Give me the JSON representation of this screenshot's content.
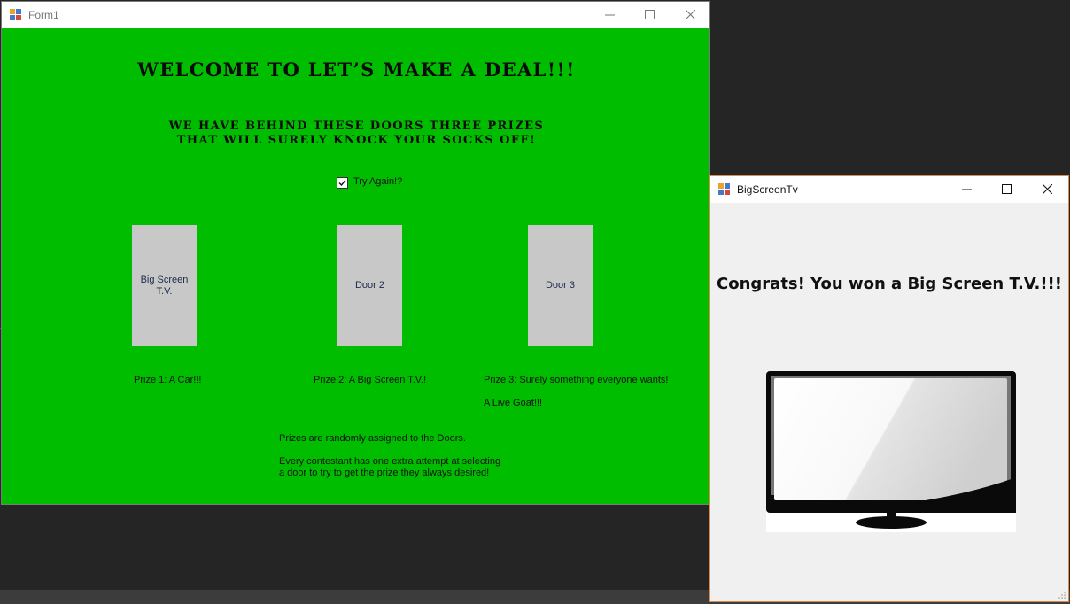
{
  "form1": {
    "title": "Form1",
    "heading": "WELCOME TO LET’S MAKE A DEAL!!!",
    "subheading_line1": "WE HAVE BEHIND THESE DOORS THREE PRIZES",
    "subheading_line2": "THAT WILL SURELY KNOCK YOUR SOCKS OFF!",
    "checkbox_label": "Try Again!?",
    "checkbox_checked": true,
    "doors": [
      {
        "line1": "Big Screen",
        "line2": "T.V."
      },
      {
        "line1": "Door 2",
        "line2": ""
      },
      {
        "line1": "Door 3",
        "line2": ""
      }
    ],
    "prizes": [
      "Prize 1: A Car!!!",
      "Prize 2: A Big Screen T.V.!",
      "Prize 3: Surely something everyone wants!",
      "A Live Goat!!!"
    ],
    "notes": {
      "random": "Prizes are randomly assigned to the Doors.",
      "attempt_line1": "Every contestant has one extra attempt at selecting",
      "attempt_line2": "a door to try to get the prize they always desired!"
    },
    "colors": {
      "background": "#00bd00",
      "door": "#c8c8c8"
    }
  },
  "bigscreentv": {
    "title": "BigScreenTv",
    "message": "Congrats! You won a Big Screen T.V.!!!"
  }
}
